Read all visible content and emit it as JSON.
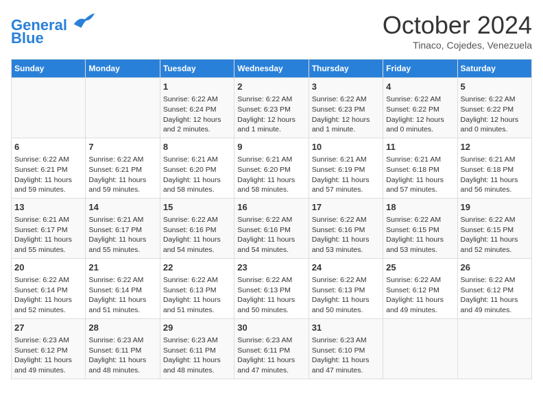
{
  "header": {
    "logo_line1": "General",
    "logo_line2": "Blue",
    "month": "October 2024",
    "location": "Tinaco, Cojedes, Venezuela"
  },
  "days_of_week": [
    "Sunday",
    "Monday",
    "Tuesday",
    "Wednesday",
    "Thursday",
    "Friday",
    "Saturday"
  ],
  "weeks": [
    [
      {
        "day": "",
        "content": ""
      },
      {
        "day": "",
        "content": ""
      },
      {
        "day": "1",
        "content": "Sunrise: 6:22 AM\nSunset: 6:24 PM\nDaylight: 12 hours and 2 minutes."
      },
      {
        "day": "2",
        "content": "Sunrise: 6:22 AM\nSunset: 6:23 PM\nDaylight: 12 hours and 1 minute."
      },
      {
        "day": "3",
        "content": "Sunrise: 6:22 AM\nSunset: 6:23 PM\nDaylight: 12 hours and 1 minute."
      },
      {
        "day": "4",
        "content": "Sunrise: 6:22 AM\nSunset: 6:22 PM\nDaylight: 12 hours and 0 minutes."
      },
      {
        "day": "5",
        "content": "Sunrise: 6:22 AM\nSunset: 6:22 PM\nDaylight: 12 hours and 0 minutes."
      }
    ],
    [
      {
        "day": "6",
        "content": "Sunrise: 6:22 AM\nSunset: 6:21 PM\nDaylight: 11 hours and 59 minutes."
      },
      {
        "day": "7",
        "content": "Sunrise: 6:22 AM\nSunset: 6:21 PM\nDaylight: 11 hours and 59 minutes."
      },
      {
        "day": "8",
        "content": "Sunrise: 6:21 AM\nSunset: 6:20 PM\nDaylight: 11 hours and 58 minutes."
      },
      {
        "day": "9",
        "content": "Sunrise: 6:21 AM\nSunset: 6:20 PM\nDaylight: 11 hours and 58 minutes."
      },
      {
        "day": "10",
        "content": "Sunrise: 6:21 AM\nSunset: 6:19 PM\nDaylight: 11 hours and 57 minutes."
      },
      {
        "day": "11",
        "content": "Sunrise: 6:21 AM\nSunset: 6:18 PM\nDaylight: 11 hours and 57 minutes."
      },
      {
        "day": "12",
        "content": "Sunrise: 6:21 AM\nSunset: 6:18 PM\nDaylight: 11 hours and 56 minutes."
      }
    ],
    [
      {
        "day": "13",
        "content": "Sunrise: 6:21 AM\nSunset: 6:17 PM\nDaylight: 11 hours and 55 minutes."
      },
      {
        "day": "14",
        "content": "Sunrise: 6:21 AM\nSunset: 6:17 PM\nDaylight: 11 hours and 55 minutes."
      },
      {
        "day": "15",
        "content": "Sunrise: 6:22 AM\nSunset: 6:16 PM\nDaylight: 11 hours and 54 minutes."
      },
      {
        "day": "16",
        "content": "Sunrise: 6:22 AM\nSunset: 6:16 PM\nDaylight: 11 hours and 54 minutes."
      },
      {
        "day": "17",
        "content": "Sunrise: 6:22 AM\nSunset: 6:16 PM\nDaylight: 11 hours and 53 minutes."
      },
      {
        "day": "18",
        "content": "Sunrise: 6:22 AM\nSunset: 6:15 PM\nDaylight: 11 hours and 53 minutes."
      },
      {
        "day": "19",
        "content": "Sunrise: 6:22 AM\nSunset: 6:15 PM\nDaylight: 11 hours and 52 minutes."
      }
    ],
    [
      {
        "day": "20",
        "content": "Sunrise: 6:22 AM\nSunset: 6:14 PM\nDaylight: 11 hours and 52 minutes."
      },
      {
        "day": "21",
        "content": "Sunrise: 6:22 AM\nSunset: 6:14 PM\nDaylight: 11 hours and 51 minutes."
      },
      {
        "day": "22",
        "content": "Sunrise: 6:22 AM\nSunset: 6:13 PM\nDaylight: 11 hours and 51 minutes."
      },
      {
        "day": "23",
        "content": "Sunrise: 6:22 AM\nSunset: 6:13 PM\nDaylight: 11 hours and 50 minutes."
      },
      {
        "day": "24",
        "content": "Sunrise: 6:22 AM\nSunset: 6:13 PM\nDaylight: 11 hours and 50 minutes."
      },
      {
        "day": "25",
        "content": "Sunrise: 6:22 AM\nSunset: 6:12 PM\nDaylight: 11 hours and 49 minutes."
      },
      {
        "day": "26",
        "content": "Sunrise: 6:22 AM\nSunset: 6:12 PM\nDaylight: 11 hours and 49 minutes."
      }
    ],
    [
      {
        "day": "27",
        "content": "Sunrise: 6:23 AM\nSunset: 6:12 PM\nDaylight: 11 hours and 49 minutes."
      },
      {
        "day": "28",
        "content": "Sunrise: 6:23 AM\nSunset: 6:11 PM\nDaylight: 11 hours and 48 minutes."
      },
      {
        "day": "29",
        "content": "Sunrise: 6:23 AM\nSunset: 6:11 PM\nDaylight: 11 hours and 48 minutes."
      },
      {
        "day": "30",
        "content": "Sunrise: 6:23 AM\nSunset: 6:11 PM\nDaylight: 11 hours and 47 minutes."
      },
      {
        "day": "31",
        "content": "Sunrise: 6:23 AM\nSunset: 6:10 PM\nDaylight: 11 hours and 47 minutes."
      },
      {
        "day": "",
        "content": ""
      },
      {
        "day": "",
        "content": ""
      }
    ]
  ]
}
